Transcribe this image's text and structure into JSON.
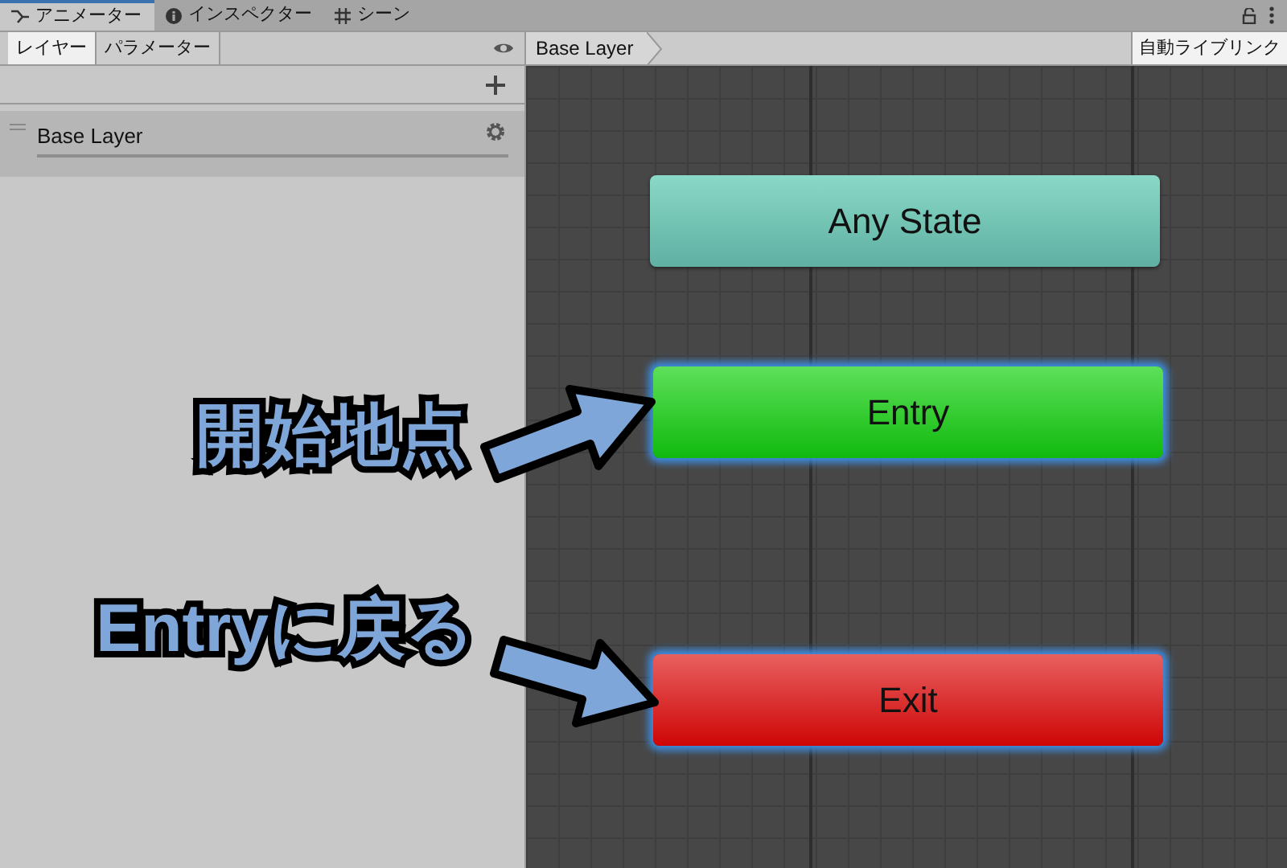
{
  "tabs": [
    {
      "label": "アニメーター",
      "kind": "animator",
      "selected": true
    },
    {
      "label": "インスペクター",
      "kind": "inspector",
      "selected": false
    },
    {
      "label": "シーン",
      "kind": "scene",
      "selected": false
    }
  ],
  "side_tabs": [
    {
      "label": "レイヤー",
      "selected": true
    },
    {
      "label": "パラメーター",
      "selected": false
    }
  ],
  "layers": [
    {
      "name": "Base Layer",
      "selected": true
    }
  ],
  "breadcrumb": "Base Layer",
  "live_link_button": "自動ライブリンク",
  "states": [
    {
      "label": "Any State",
      "kind": "any",
      "highlighted": false
    },
    {
      "label": "Entry",
      "kind": "entry",
      "highlighted": true
    },
    {
      "label": "Exit",
      "kind": "exit",
      "highlighted": true
    }
  ],
  "annotations": [
    {
      "text": "開始地点"
    },
    {
      "text": "Entryに戻る"
    }
  ]
}
